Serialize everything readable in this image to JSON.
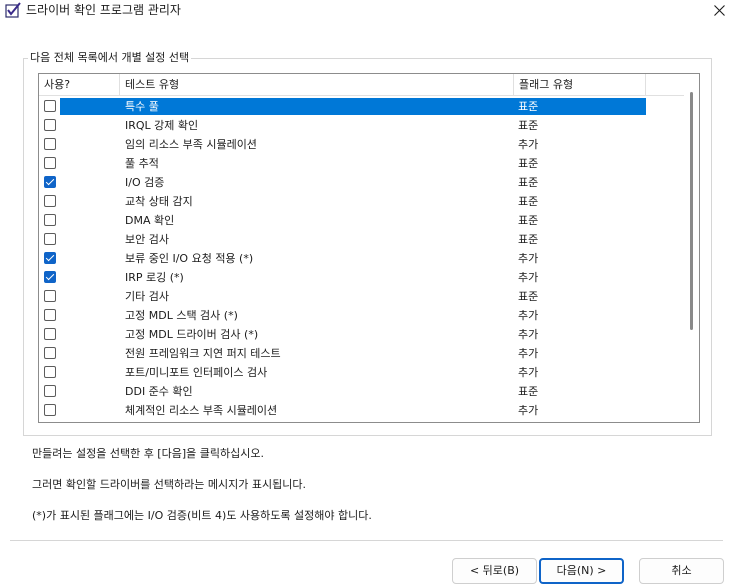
{
  "window": {
    "title": "드라이버 확인 프로그램 관리자",
    "icon": "driver-verifier-checkmark-icon",
    "close_icon": "close-icon"
  },
  "group": {
    "legend": "다음 전체 목록에서 개별 설정 선택"
  },
  "list": {
    "columns": [
      "사용?",
      "테스트 유형",
      "플래그 유형"
    ],
    "rows": [
      {
        "checked": false,
        "name": "특수 풀",
        "type": "표준",
        "selected": true
      },
      {
        "checked": false,
        "name": "IRQL 강제 확인",
        "type": "표준",
        "selected": false
      },
      {
        "checked": false,
        "name": "임의 리소스 부족 시뮬레이션",
        "type": "추가",
        "selected": false
      },
      {
        "checked": false,
        "name": "풀 추적",
        "type": "표준",
        "selected": false
      },
      {
        "checked": true,
        "name": "I/O 검증",
        "type": "표준",
        "selected": false
      },
      {
        "checked": false,
        "name": "교착 상태 감지",
        "type": "표준",
        "selected": false
      },
      {
        "checked": false,
        "name": "DMA 확인",
        "type": "표준",
        "selected": false
      },
      {
        "checked": false,
        "name": "보안 검사",
        "type": "표준",
        "selected": false
      },
      {
        "checked": true,
        "name": "보류 중인 I/O 요청 적용 (*)",
        "type": "추가",
        "selected": false
      },
      {
        "checked": true,
        "name": "IRP 로깅 (*)",
        "type": "추가",
        "selected": false
      },
      {
        "checked": false,
        "name": "기타 검사",
        "type": "표준",
        "selected": false
      },
      {
        "checked": false,
        "name": "고정 MDL 스택 검사 (*)",
        "type": "추가",
        "selected": false
      },
      {
        "checked": false,
        "name": "고정 MDL 드라이버 검사 (*)",
        "type": "추가",
        "selected": false
      },
      {
        "checked": false,
        "name": "전원 프레임워크 지연 퍼지 테스트",
        "type": "추가",
        "selected": false
      },
      {
        "checked": false,
        "name": "포트/미니포트 인터페이스 검사",
        "type": "추가",
        "selected": false
      },
      {
        "checked": false,
        "name": "DDI 준수 확인",
        "type": "표준",
        "selected": false
      },
      {
        "checked": false,
        "name": "체계적인 리소스 부족 시뮬레이션",
        "type": "추가",
        "selected": false
      }
    ]
  },
  "info": {
    "line1": "만들려는 설정을 선택한 후 [다음]을 클릭하십시오.",
    "line2": "그러면 확인할 드라이버를 선택하라는 메시지가 표시됩니다.",
    "line3": "(*)가 표시된 플래그에는 I/O 검증(비트 4)도 사용하도록 설정해야 합니다."
  },
  "buttons": {
    "back": "< 뒤로(B)",
    "next": "다음(N) >",
    "cancel": "취소"
  },
  "colors": {
    "selection": "#0078d7",
    "check_accent": "#0f64c8"
  }
}
